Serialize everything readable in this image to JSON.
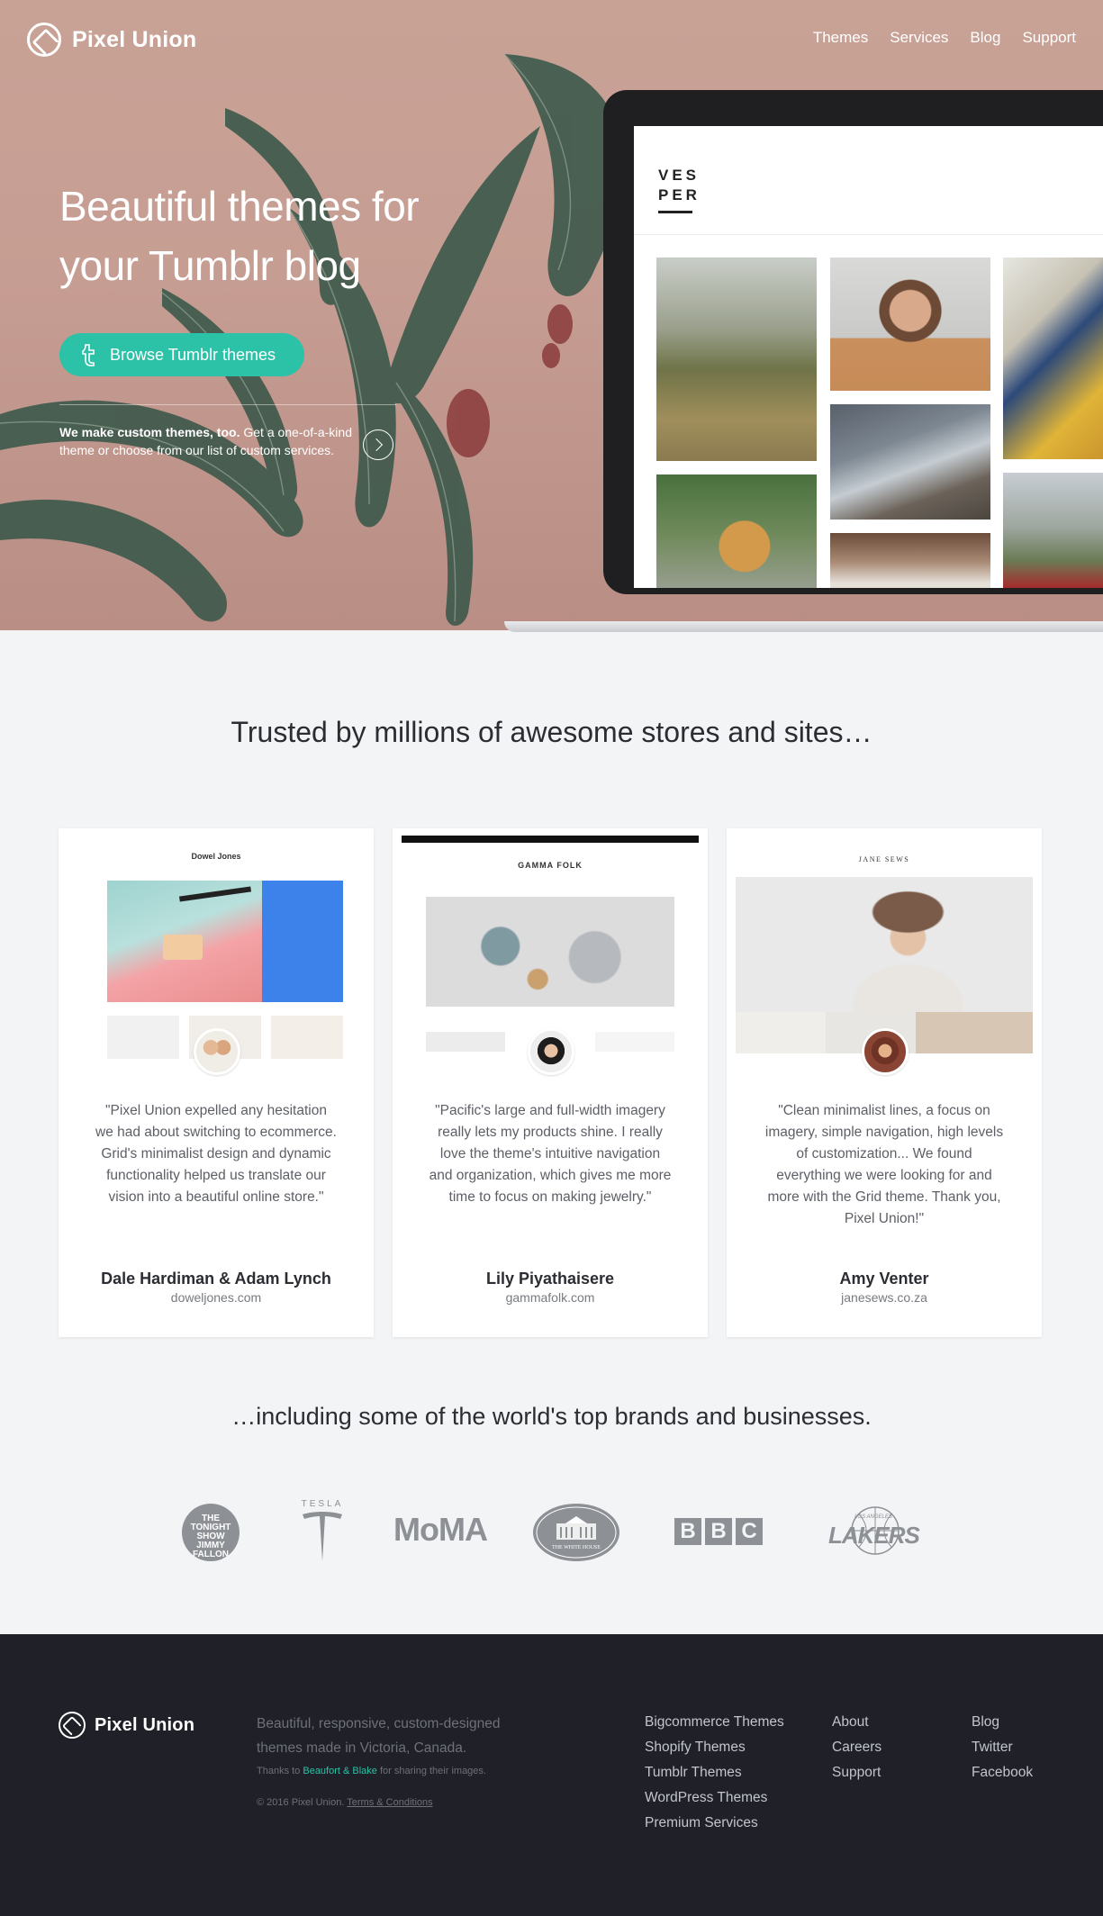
{
  "nav": {
    "brand": "Pixel Union",
    "links": [
      "Themes",
      "Services",
      "Blog",
      "Support"
    ]
  },
  "hero": {
    "title": "Beautiful themes for your Tumblr blog",
    "button_label": "Browse Tumblr themes",
    "note_bold": "We make custom themes, too.",
    "note_rest": " Get a one-of-a-kind theme or choose from our list of custom services."
  },
  "laptop": {
    "brand_line1": "VES",
    "brand_line2": "PER"
  },
  "trusted": {
    "title": "Trusted by millions of awesome stores and sites…",
    "cards": [
      {
        "quote": "\"Pixel Union expelled any hesitation we had about switching to ecommerce. Grid's minimalist design and dynamic functionality helped us translate our vision into a beautiful online store.\"",
        "name": "Dale Hardiman & Adam Lynch",
        "site": "doweljones.com",
        "shot_logo": "Dowel Jones"
      },
      {
        "quote": "\"Pacific's large and full-width imagery really lets my products shine. I really love the theme's intuitive navigation and organization, which gives me more time to focus on making jewelry.\"",
        "name": "Lily Piyathaisere",
        "site": "gammafolk.com",
        "shot_logo": "GAMMA FOLK"
      },
      {
        "quote": "\"Clean minimalist lines, a focus on imagery, simple navigation, high levels of customization... We found everything we were looking for and more with the Grid theme. Thank you, Pixel Union!\"",
        "name": "Amy Venter",
        "site": "janesews.co.za",
        "shot_logo": "JANE SEWS"
      }
    ]
  },
  "brands": {
    "title": "…including some of the world's top brands and businesses.",
    "logos": {
      "tonight_show": "THE TONIGHT SHOW JIMMY FALLON",
      "tesla": "TESLA",
      "moma": "MoMA",
      "white_house": "THE WHITE HOUSE",
      "bbc": [
        "B",
        "B",
        "C"
      ],
      "lakers": "LAKERS",
      "lakers_top": "LOS ANGELES"
    }
  },
  "footer": {
    "brand": "Pixel Union",
    "description": "Beautiful, responsive, custom-designed themes made in Victoria, Canada.",
    "thanks_prefix": "Thanks to ",
    "thanks_link": "Beaufort & Blake",
    "thanks_suffix": " for sharing their images.",
    "copyright": "© 2016 Pixel Union. ",
    "terms": "Terms & Conditions",
    "col1": [
      "Bigcommerce Themes",
      "Shopify Themes",
      "Tumblr Themes",
      "WordPress Themes",
      "Premium Services"
    ],
    "col2": [
      "About",
      "Careers",
      "Support"
    ],
    "col3": [
      "Blog",
      "Twitter",
      "Facebook"
    ]
  },
  "colors": {
    "accent": "#2cc2a7",
    "hero_bg": "#c69d92",
    "footer_bg": "#1f2028",
    "page_bg": "#f3f4f6"
  }
}
